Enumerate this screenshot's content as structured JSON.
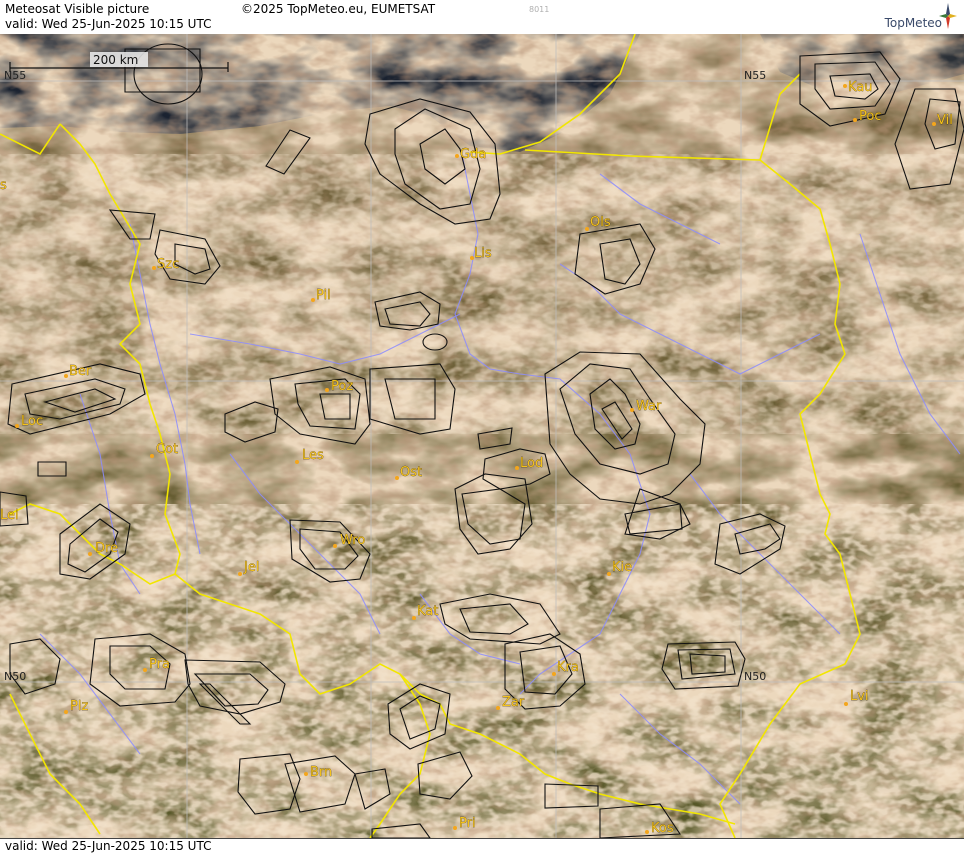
{
  "header": {
    "title": "Meteosat Visible picture",
    "copyright": "©2025 TopMeteo.eu, EUMETSAT",
    "valid": "valid:  Wed  25-Jun-2025  10:15 UTC",
    "code": "8011",
    "logo_text": "TopMeteo"
  },
  "footer": {
    "valid": "valid:  Wed  25-Jun-2025  10:15 UTC"
  },
  "scale_bar": {
    "label": "200 km"
  },
  "grid_labels": [
    "N55",
    "N55",
    "N50",
    "N50"
  ],
  "cities": [
    "Gda",
    "Kau",
    "Poc",
    "Vil",
    "Ols",
    "Szc",
    "Lis",
    "Pil",
    "Ber",
    "Poz",
    "Loc",
    "War",
    "Cot",
    "Les",
    "Ost",
    "Lod",
    "Lei",
    "Dre",
    "Wro",
    "Jel",
    "Kie",
    "Kat",
    "Pra",
    "Kra",
    "Lvi",
    "Plz",
    "Zar",
    "Brn",
    "Pri",
    "Kos",
    "s"
  ],
  "colors": {
    "border": "#f2e600",
    "river": "#8c8cff",
    "grid": "#b8b8b8",
    "cloud_light": "#efdcc0",
    "cloud_shade": "#c9a98e",
    "land": "#5e5a2c",
    "contour": "#111111",
    "city": "#f4c21c"
  }
}
